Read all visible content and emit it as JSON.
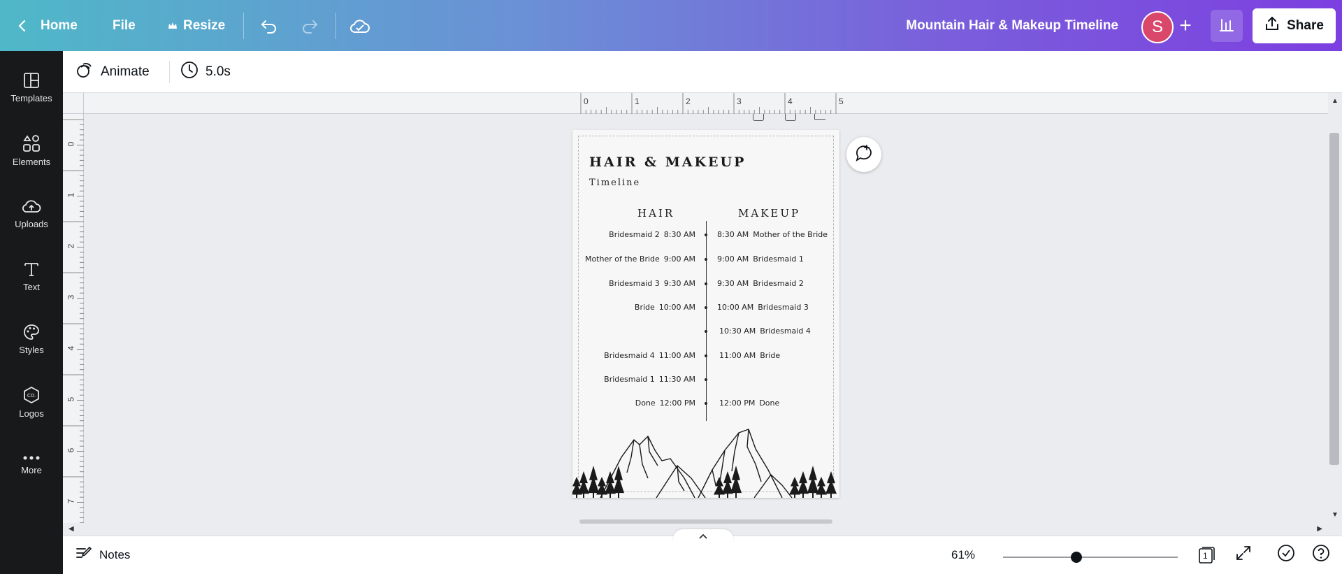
{
  "topbar": {
    "home_label": "Home",
    "file_label": "File",
    "resize_label": "Resize",
    "doc_title": "Mountain Hair & Makeup Timeline",
    "avatar_initial": "S",
    "add_label": "+",
    "share_label": "Share"
  },
  "sidebar": {
    "items": [
      {
        "label": "Templates",
        "icon": "templates-icon"
      },
      {
        "label": "Elements",
        "icon": "elements-icon"
      },
      {
        "label": "Uploads",
        "icon": "uploads-icon"
      },
      {
        "label": "Text",
        "icon": "text-icon"
      },
      {
        "label": "Styles",
        "icon": "styles-icon"
      },
      {
        "label": "Logos",
        "icon": "logos-icon"
      },
      {
        "label": "More",
        "icon": "more-icon"
      }
    ]
  },
  "toolbar": {
    "animate_label": "Animate",
    "duration_label": "5.0s"
  },
  "ruler": {
    "h_labels": [
      "0",
      "1",
      "2",
      "3",
      "4",
      "5"
    ],
    "v_labels": [
      "0",
      "1",
      "2",
      "3",
      "4",
      "5",
      "6",
      "7"
    ]
  },
  "design": {
    "title": "HAIR & MAKEUP",
    "subtitle": "Timeline",
    "hair_heading": "HAIR",
    "makeup_heading": "MAKEUP",
    "hair_rows": [
      {
        "name": "Bridesmaid 2",
        "time": "8:30 AM"
      },
      {
        "name": "Mother of the Bride",
        "time": "9:00 AM"
      },
      {
        "name": "Bridesmaid 3",
        "time": "9:30 AM"
      },
      {
        "name": "Bride",
        "time": "10:00 AM"
      },
      {
        "name": "Bridesmaid 4",
        "time": "11:00 AM"
      },
      {
        "name": "Bridesmaid 1",
        "time": "11:30 AM"
      },
      {
        "name": "Done",
        "time": "12:00 PM"
      }
    ],
    "makeup_rows": [
      {
        "time": "8:30 AM",
        "name": "Mother of the Bride"
      },
      {
        "time": "9:00 AM",
        "name": "Bridesmaid 1"
      },
      {
        "time": "9:30 AM",
        "name": "Bridesmaid 2"
      },
      {
        "time": "10:00 AM",
        "name": "Bridesmaid 3"
      },
      {
        "time": "10:30 AM",
        "name": "Bridesmaid 4"
      },
      {
        "time": "11:00 AM",
        "name": "Bride"
      },
      {
        "time": "12:00 PM",
        "name": "Done"
      }
    ]
  },
  "bottombar": {
    "notes_label": "Notes",
    "zoom_label": "61%",
    "zoom_fraction": 0.42,
    "page_count": "1"
  },
  "colors": {
    "gradient_start": "#4fb8c8",
    "gradient_end": "#7c3fe0",
    "avatar": "#d9476a",
    "sidebar": "#18191b"
  }
}
